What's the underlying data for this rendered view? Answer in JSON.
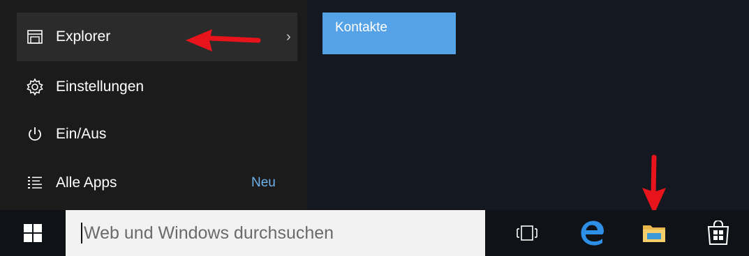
{
  "start_menu": {
    "items": [
      {
        "label": "Explorer",
        "icon": "file-explorer-icon"
      },
      {
        "label": "Einstellungen",
        "icon": "gear-icon"
      },
      {
        "label": "Ein/Aus",
        "icon": "power-icon"
      },
      {
        "label": "Alle Apps",
        "icon": "all-apps-list-icon"
      }
    ],
    "explorer_chevron": "›",
    "all_apps_badge": "Neu"
  },
  "tiles": [
    {
      "label": "Kontakte",
      "color": "#55a3e6"
    }
  ],
  "taskbar": {
    "search_placeholder": "Web und Windows durchsuchen",
    "icons": [
      "windows-start-icon",
      "task-view-icon",
      "edge-icon",
      "file-explorer-icon",
      "store-icon"
    ]
  },
  "annotations": {
    "arrow_color": "#e8141b"
  }
}
